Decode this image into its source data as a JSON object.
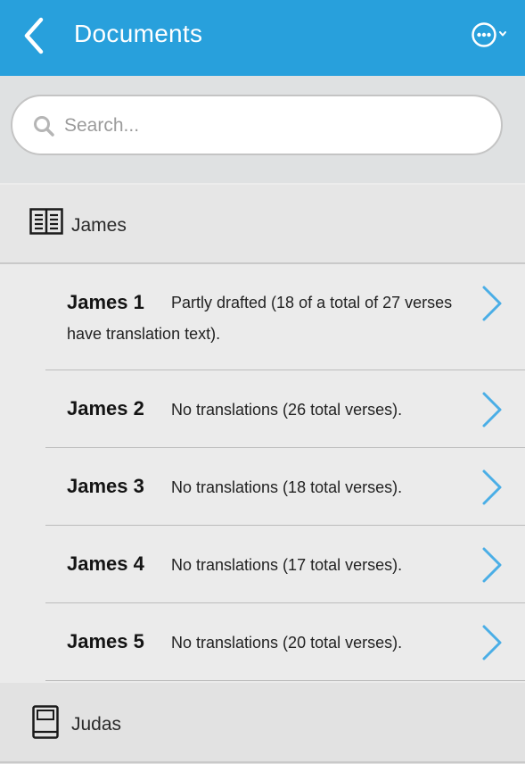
{
  "header": {
    "title": "Documents",
    "back_icon": "chevron-left-icon",
    "more_icon": "ellipsis-circle-icon",
    "color": "#28a0dc"
  },
  "search": {
    "placeholder": "Search..."
  },
  "books": [
    {
      "label": "James",
      "icon": "open-book-icon",
      "chapters": [
        {
          "name": "James 1",
          "status_line1": "Partly drafted (18 of a total of 27 verses",
          "status_line2": "have translation text)."
        },
        {
          "name": "James 2",
          "status_line1": "No translations (26 total verses)."
        },
        {
          "name": "James 3",
          "status_line1": "No translations (18 total verses)."
        },
        {
          "name": "James 4",
          "status_line1": "No translations (17 total verses)."
        },
        {
          "name": "James 5",
          "status_line1": "No translations (20 total verses)."
        }
      ]
    },
    {
      "label": "Judas",
      "icon": "closed-book-icon"
    }
  ],
  "accent_color": "#4aaee6"
}
